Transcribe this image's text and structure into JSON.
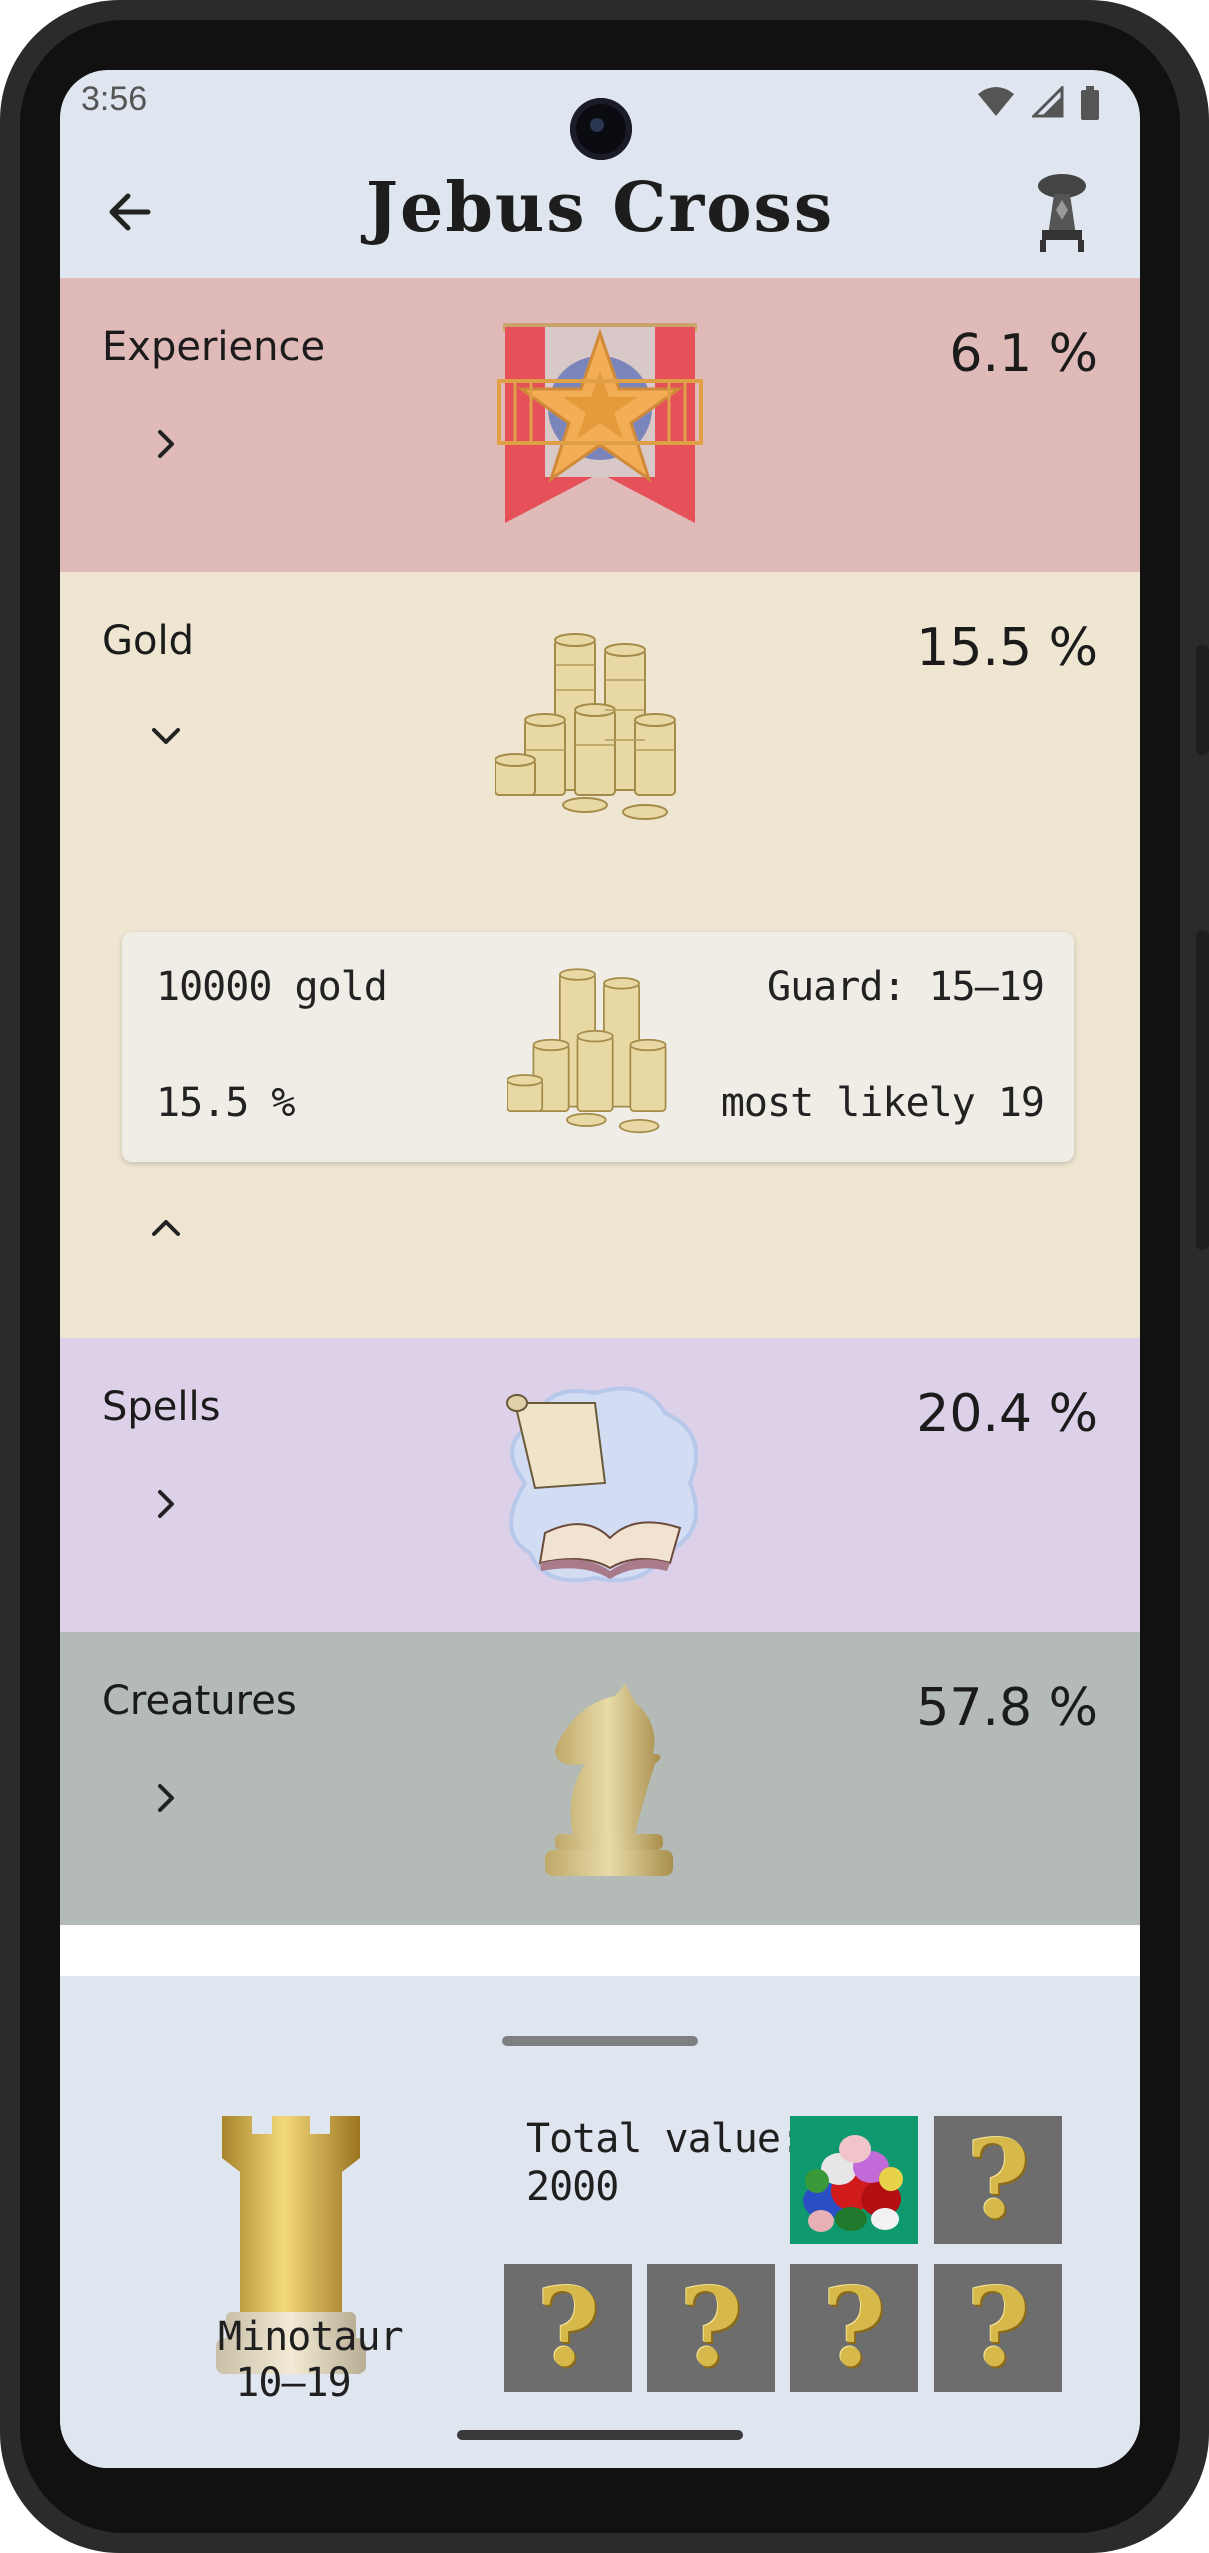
{
  "status_bar": {
    "time": "3:56"
  },
  "app_bar": {
    "title": "Jebus Cross"
  },
  "sections": {
    "experience": {
      "label": "Experience",
      "percent": "6.1 %"
    },
    "gold": {
      "label": "Gold",
      "percent": "15.5 %",
      "card": {
        "amount": "10000 gold",
        "percent": "15.5 %",
        "guard": "Guard: 15–19",
        "most_likely": "most likely 19"
      }
    },
    "spells": {
      "label": "Spells",
      "percent": "20.4 %"
    },
    "creatures": {
      "label": "Creatures",
      "percent": "57.8 %"
    }
  },
  "bottom_sheet": {
    "guard_name": "Minotaur",
    "guard_range": "10–19",
    "total_value_label": "Total value:",
    "total_value": "2000",
    "reward_slots": [
      "gems",
      "unknown",
      "unknown",
      "unknown",
      "unknown",
      "unknown"
    ]
  },
  "colors": {
    "experience_bg": "#dfbab9",
    "gold_bg": "#efe6d2",
    "spells_bg": "#ddd0e9",
    "creatures_bg": "#b4bab6",
    "screen_bg": "#dfe6ef",
    "tile_bg": "#6d6d6d",
    "gems_bg": "#0e9a6e"
  }
}
